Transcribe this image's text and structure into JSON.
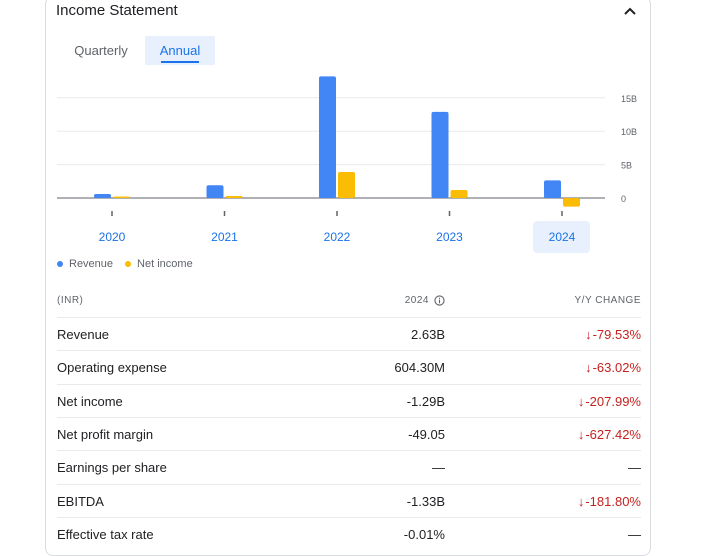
{
  "card": {
    "title": "Income Statement"
  },
  "tabs": [
    {
      "label": "Quarterly",
      "selected": false
    },
    {
      "label": "Annual",
      "selected": true
    }
  ],
  "chart_data": {
    "type": "bar",
    "categories": [
      "2020",
      "2021",
      "2022",
      "2023",
      "2024"
    ],
    "selected_category": "2024",
    "series": [
      {
        "name": "Revenue",
        "color": "#4285f4",
        "values": [
          0.6,
          1.9,
          18.2,
          12.9,
          2.63
        ]
      },
      {
        "name": "Net income",
        "color": "#fbbc04",
        "values": [
          0.1,
          0.3,
          3.9,
          1.2,
          -1.29
        ]
      }
    ],
    "y_ticks": [
      "15B",
      "10B",
      "5B",
      "0"
    ],
    "y_tick_values": [
      15,
      10,
      5,
      0
    ],
    "ylim": [
      -1.6,
      18.4
    ],
    "unit": "B",
    "grid": true,
    "legend_position": "bottom-left"
  },
  "legend": [
    {
      "label": "Revenue",
      "color": "#4285f4"
    },
    {
      "label": "Net income",
      "color": "#fbbc04"
    }
  ],
  "table": {
    "header": {
      "label": "(INR)",
      "year": "2024",
      "change": "Y/Y CHANGE"
    },
    "rows": [
      {
        "label": "Revenue",
        "value": "2.63B",
        "change": "-79.53%",
        "trend": "down"
      },
      {
        "label": "Operating expense",
        "value": "604.30M",
        "change": "-63.02%",
        "trend": "down"
      },
      {
        "label": "Net income",
        "value": "-1.29B",
        "change": "-207.99%",
        "trend": "down"
      },
      {
        "label": "Net profit margin",
        "value": "-49.05",
        "change": "-627.42%",
        "trend": "down"
      },
      {
        "label": "Earnings per share",
        "value": "—",
        "change": "—",
        "trend": "none"
      },
      {
        "label": "EBITDA",
        "value": "-1.33B",
        "change": "-181.80%",
        "trend": "down"
      },
      {
        "label": "Effective tax rate",
        "value": "-0.01%",
        "change": "—",
        "trend": "none"
      }
    ]
  },
  "icons": {
    "collapse": "chevron-up-icon",
    "info": "info-icon",
    "down_arrow": "arrow-down-icon"
  }
}
